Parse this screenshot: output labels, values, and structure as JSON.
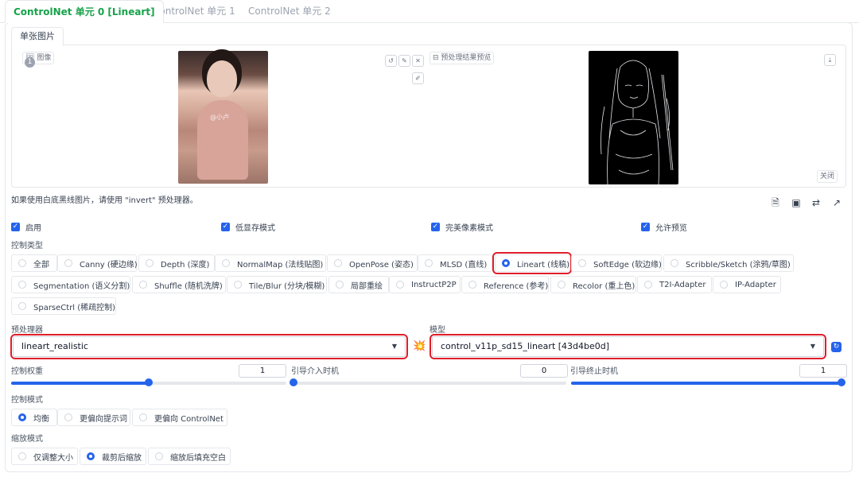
{
  "tabs": [
    {
      "label": "ControlNet 单元 0 [Lineart]"
    },
    {
      "label": "ControlNet 单元 1"
    },
    {
      "label": "ControlNet 单元 2"
    }
  ],
  "image_tab": "单张图片",
  "image_panel": {
    "input_label": "图像",
    "preview_button": "预处理结果预览",
    "close_button": "关闭",
    "watermark": "@小卢"
  },
  "note": "如果使用白底黑线图片，请使用 \"invert\" 预处理器。",
  "checkboxes": [
    {
      "label": "启用",
      "checked": true
    },
    {
      "label": "低显存模式",
      "checked": true
    },
    {
      "label": "完美像素模式",
      "checked": true
    },
    {
      "label": "允许预览",
      "checked": true
    }
  ],
  "control_type": {
    "label": "控制类型",
    "selected": "Lineart (线稿)",
    "options": [
      "全部",
      "Canny (硬边缘)",
      "Depth (深度)",
      "NormalMap (法线贴图)",
      "OpenPose (姿态)",
      "MLSD (直线)",
      "Lineart (线稿)",
      "SoftEdge (软边缘)",
      "Scribble/Sketch (涂鸦/草图)",
      "Segmentation (语义分割)",
      "Shuffle (随机洗牌)",
      "Tile/Blur (分块/模糊)",
      "局部重绘",
      "InstructP2P",
      "Reference (参考)",
      "Recolor (重上色)",
      "T2I-Adapter",
      "IP-Adapter",
      "SparseCtrl (稀疏控制)"
    ]
  },
  "preprocessor": {
    "label": "预处理器",
    "value": "lineart_realistic"
  },
  "model": {
    "label": "模型",
    "value": "control_v11p_sd15_lineart [43d4be0d]"
  },
  "sliders": [
    {
      "label": "控制权重",
      "value": "1",
      "fraction": 0.5
    },
    {
      "label": "引导介入时机",
      "value": "0",
      "fraction": 0.0
    },
    {
      "label": "引导终止时机",
      "value": "1",
      "fraction": 1.0
    }
  ],
  "control_mode": {
    "label": "控制模式",
    "selected": "均衡",
    "options": [
      "均衡",
      "更偏向提示词",
      "更偏向 ControlNet"
    ]
  },
  "resize_mode": {
    "label": "缩放模式",
    "selected": "裁剪后缩放",
    "options": [
      "仅调整大小",
      "裁剪后缩放",
      "缩放后填充空白"
    ]
  },
  "colors": {
    "accent": "#2563eb",
    "active_tab": "#16a34a",
    "highlight": "#e11d2a"
  }
}
